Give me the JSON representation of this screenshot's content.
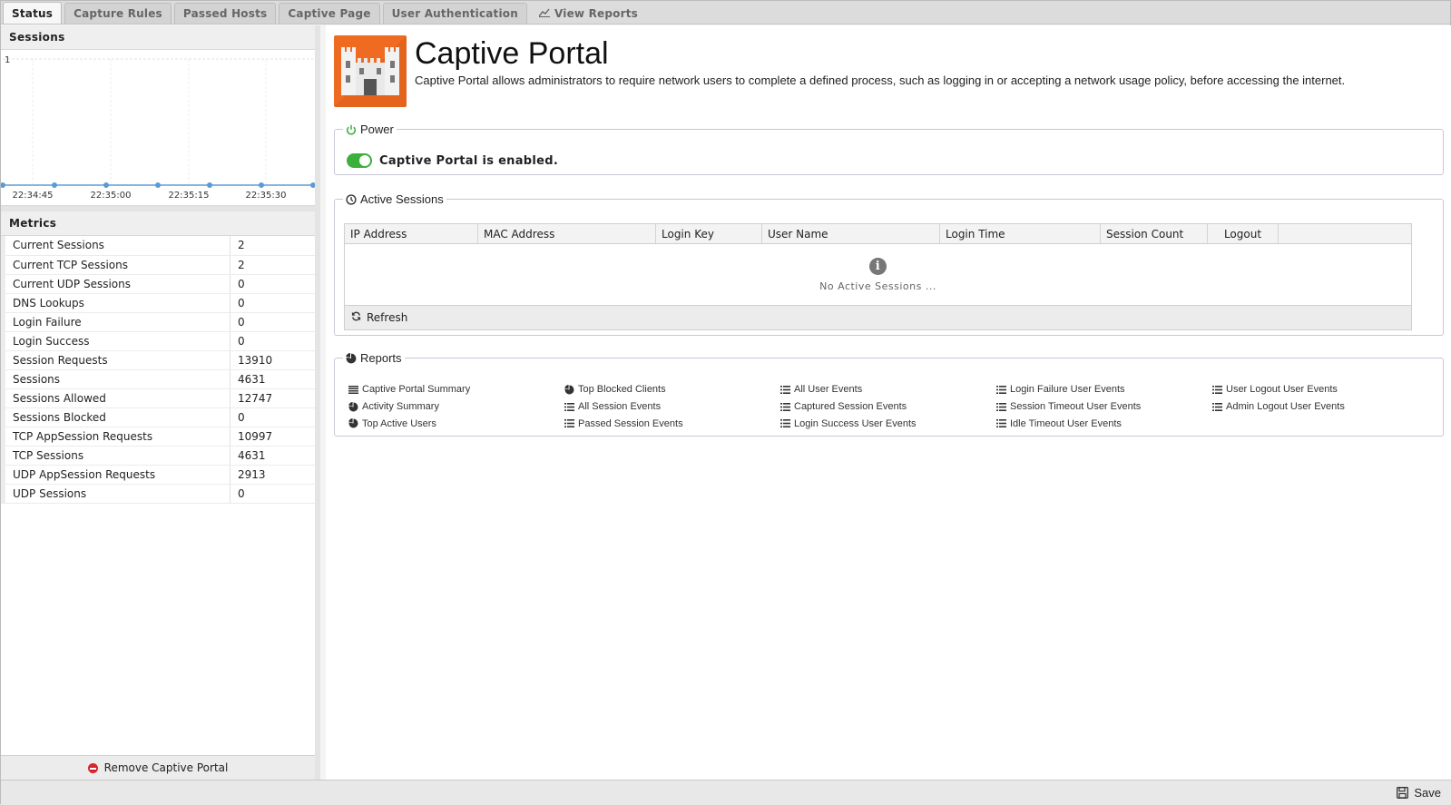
{
  "tabs": [
    {
      "label": "Status",
      "active": true
    },
    {
      "label": "Capture Rules"
    },
    {
      "label": "Passed Hosts"
    },
    {
      "label": "Captive Page"
    },
    {
      "label": "User Authentication"
    },
    {
      "label": "View Reports",
      "icon": "line-chart-icon"
    }
  ],
  "sessions_panel": {
    "title": "Sessions"
  },
  "chart_data": {
    "type": "line",
    "x": [
      "22:34:45",
      "22:35:00",
      "22:35:15",
      "22:35:30"
    ],
    "x_ticks": [
      "22:34:45",
      "22:35:00",
      "22:35:15",
      "22:35:30"
    ],
    "y_ticks": [
      "1"
    ],
    "ylim": [
      0,
      1
    ],
    "series": [
      {
        "values": [
          0,
          0,
          0,
          0,
          0,
          0,
          0
        ]
      }
    ],
    "color": "#5b9bd5",
    "grid": true
  },
  "metrics_panel": {
    "title": "Metrics",
    "rows": [
      {
        "name": "Current Sessions",
        "value": "2"
      },
      {
        "name": "Current TCP Sessions",
        "value": "2"
      },
      {
        "name": "Current UDP Sessions",
        "value": "0"
      },
      {
        "name": "DNS Lookups",
        "value": "0"
      },
      {
        "name": "Login Failure",
        "value": "0"
      },
      {
        "name": "Login Success",
        "value": "0"
      },
      {
        "name": "Session Requests",
        "value": "13910"
      },
      {
        "name": "Sessions",
        "value": "4631"
      },
      {
        "name": "Sessions Allowed",
        "value": "12747"
      },
      {
        "name": "Sessions Blocked",
        "value": "0"
      },
      {
        "name": "TCP AppSession Requests",
        "value": "10997"
      },
      {
        "name": "TCP Sessions",
        "value": "4631"
      },
      {
        "name": "UDP AppSession Requests",
        "value": "2913"
      },
      {
        "name": "UDP Sessions",
        "value": "0"
      }
    ]
  },
  "remove_label": "Remove Captive Portal",
  "app": {
    "title": "Captive Portal",
    "description": "Captive Portal allows administrators to require network users to complete a defined process, such as logging in or accepting a network usage policy, before accessing the internet.",
    "logo_color": "#ee6b21"
  },
  "power": {
    "legend": "Power",
    "status_text": "Captive Portal is enabled.",
    "enabled": true,
    "color": "#3bb03b"
  },
  "active_sessions": {
    "legend": "Active Sessions",
    "columns": [
      "IP Address",
      "MAC Address",
      "Login Key",
      "User Name",
      "Login Time",
      "Session Count",
      "Logout"
    ],
    "empty_text": "No Active Sessions ...",
    "refresh_label": "Refresh"
  },
  "reports": {
    "legend": "Reports",
    "columns": [
      [
        {
          "label": "Captive Portal Summary",
          "icon": "text-lines-icon"
        },
        {
          "label": "Activity Summary",
          "icon": "pie-chart-icon"
        },
        {
          "label": "Top Active Users",
          "icon": "pie-chart-icon"
        }
      ],
      [
        {
          "label": "Top Blocked Clients",
          "icon": "pie-chart-icon"
        },
        {
          "label": "All Session Events",
          "icon": "list-icon"
        },
        {
          "label": "Passed Session Events",
          "icon": "list-icon"
        }
      ],
      [
        {
          "label": "All User Events",
          "icon": "list-icon"
        },
        {
          "label": "Captured Session Events",
          "icon": "list-icon"
        },
        {
          "label": "Login Success User Events",
          "icon": "list-icon"
        }
      ],
      [
        {
          "label": "Login Failure User Events",
          "icon": "list-icon"
        },
        {
          "label": "Session Timeout User Events",
          "icon": "list-icon"
        },
        {
          "label": "Idle Timeout User Events",
          "icon": "list-icon"
        }
      ],
      [
        {
          "label": "User Logout User Events",
          "icon": "list-icon"
        },
        {
          "label": "Admin Logout User Events",
          "icon": "list-icon"
        }
      ]
    ]
  },
  "save_label": "Save"
}
